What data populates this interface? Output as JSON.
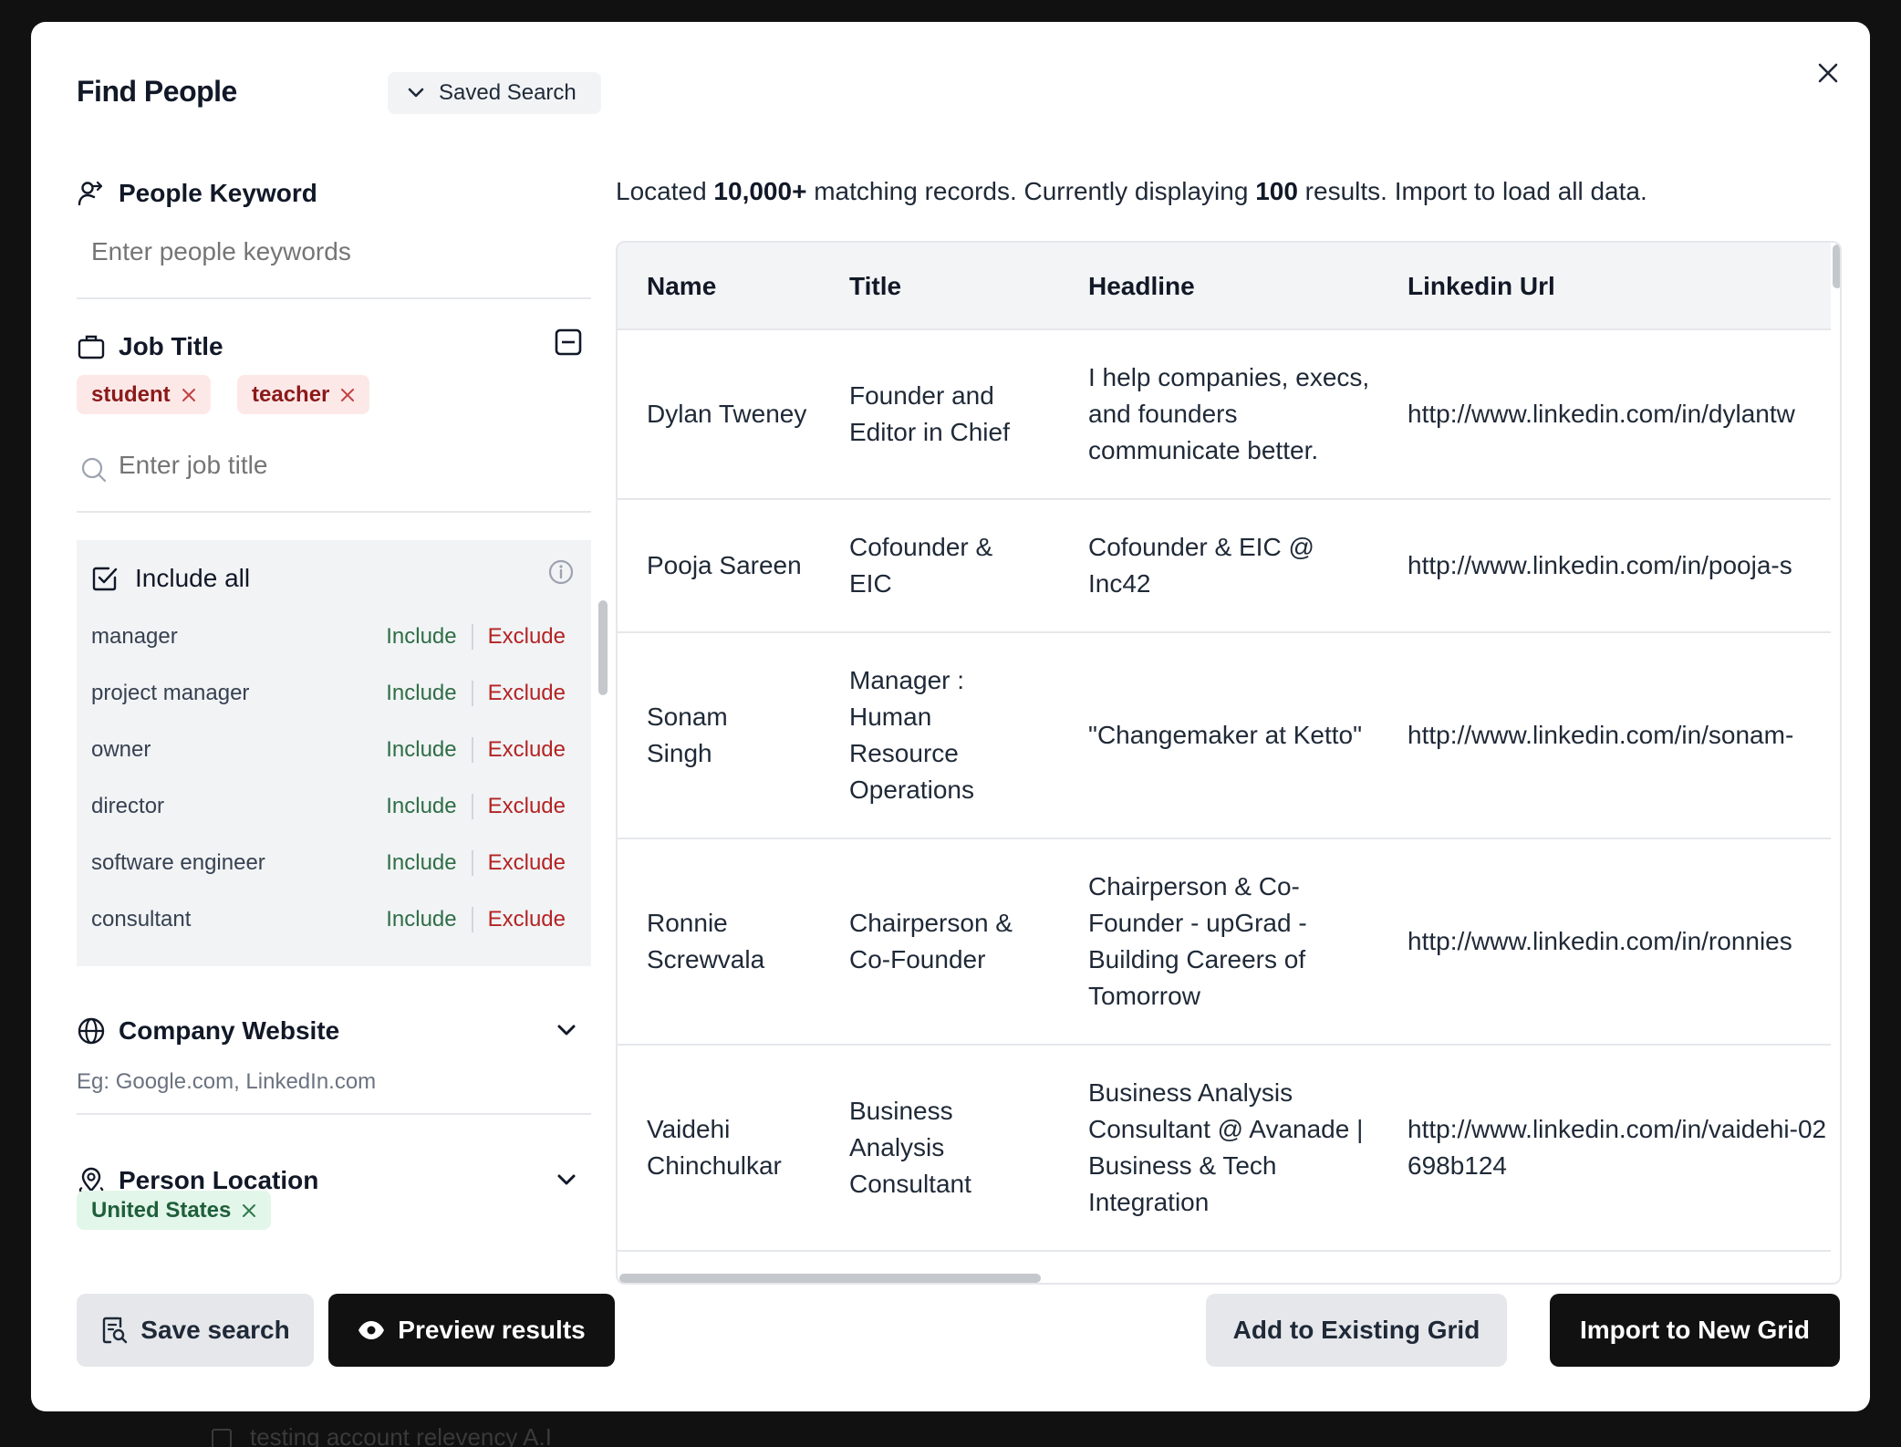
{
  "backdrop": {
    "row_text": "testing account relevency A.I"
  },
  "modal": {
    "title": "Find People",
    "saved_search_label": "Saved Search"
  },
  "filters": {
    "people_keyword": {
      "label": "People Keyword",
      "placeholder": "Enter people keywords"
    },
    "job_title": {
      "label": "Job Title",
      "chips": [
        "student",
        "teacher"
      ],
      "placeholder": "Enter job title",
      "include_all_label": "Include all",
      "include_label": "Include",
      "exclude_label": "Exclude",
      "suggestions": [
        "manager",
        "project manager",
        "owner",
        "director",
        "software engineer",
        "consultant"
      ]
    },
    "company_website": {
      "label": "Company Website",
      "hint": "Eg: Google.com, LinkedIn.com"
    },
    "person_location": {
      "label": "Person Location",
      "chips": [
        "United States"
      ]
    }
  },
  "results": {
    "summary_prefix": "Located ",
    "summary_count": "10,000+",
    "summary_middle": " matching records. Currently displaying ",
    "summary_shown": "100",
    "summary_suffix": " results. Import to load all data.",
    "columns": [
      "Name",
      "Title",
      "Headline",
      "Linkedin Url"
    ],
    "rows": [
      {
        "name": "Dylan Tweney",
        "title": "Founder and Editor in Chief",
        "headline": "I help companies, execs, and founders communicate better.",
        "url": "http://www.linkedin.com/in/dylantw"
      },
      {
        "name": "Pooja Sareen",
        "title": "Cofounder & EIC",
        "headline": "Cofounder & EIC @ Inc42",
        "url": "http://www.linkedin.com/in/pooja-s"
      },
      {
        "name": "Sonam Singh",
        "title": "Manager : Human Resource Operations",
        "headline": "\"Changemaker at Ketto\"",
        "url": "http://www.linkedin.com/in/sonam-"
      },
      {
        "name": "Ronnie Screwvala",
        "title": "Chairperson & Co-Founder",
        "headline": "Chairperson & Co-Founder - upGrad - Building Careers of Tomorrow",
        "url": "http://www.linkedin.com/in/ronnies"
      },
      {
        "name": "Vaidehi Chinchulkar",
        "title": "Business Analysis Consultant",
        "headline": "Business Analysis Consultant @ Avanade | Business & Tech Integration",
        "url": "http://www.linkedin.com/in/vaidehi-02698b124"
      }
    ]
  },
  "footer": {
    "save_search": "Save search",
    "preview_results": "Preview results",
    "add_existing": "Add to Existing Grid",
    "import_new": "Import to New Grid"
  },
  "colors": {
    "include": "#2f6e46",
    "exclude": "#b42323",
    "chip_red_bg": "#fde8e8",
    "chip_green_bg": "#e3f6ea",
    "primary_dark": "#111111"
  }
}
